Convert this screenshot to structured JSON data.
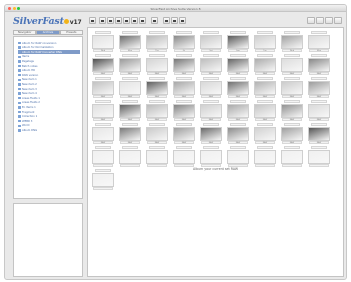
{
  "window": {
    "title": "SilverFast Archive Suite Version 8"
  },
  "logo": {
    "text": "SilverFast",
    "version": "v17"
  },
  "tabs": [
    {
      "label": "Navigator"
    },
    {
      "label": "Archive"
    },
    {
      "label": "Presets"
    }
  ],
  "sidebar": {
    "items": [
      {
        "label": "Album for RAW conversion",
        "selected": false
      },
      {
        "label": "Album for Normalization",
        "selected": false
      },
      {
        "label": "Album for RAW Converter DNG",
        "selected": true
      },
      {
        "label": "Items",
        "selected": false
      },
      {
        "label": "Pagetags",
        "selected": false
      },
      {
        "label": "Batch notes",
        "selected": false
      },
      {
        "label": "Album HR",
        "selected": false
      },
      {
        "label": "RAW version",
        "selected": false
      },
      {
        "label": "New item 1",
        "selected": false
      },
      {
        "label": "New item 2",
        "selected": false
      },
      {
        "label": "New item 3",
        "selected": false
      },
      {
        "label": "New item 4",
        "selected": false
      },
      {
        "label": "Areas Fields 1",
        "selected": false
      },
      {
        "label": "Areas Fields 2",
        "selected": false
      },
      {
        "label": "En Items 1",
        "selected": false
      },
      {
        "label": "Fragment",
        "selected": false
      },
      {
        "label": "Collection 1",
        "selected": false
      },
      {
        "label": "WEBD 3",
        "selected": false
      },
      {
        "label": "World",
        "selected": false
      },
      {
        "label": "Album DNG",
        "selected": false
      }
    ]
  },
  "toolbar": {
    "icons": [
      "lightbox-icon",
      "grid-icon",
      "list-icon",
      "filmstrip-icon",
      "zoom-icon",
      "rotate-icon",
      "print-icon",
      "undo-icon",
      "redo-icon",
      "tag-icon",
      "info-icon"
    ],
    "right_icons": [
      "settings-icon",
      "view-icon",
      "export-icon",
      "help-icon"
    ]
  },
  "thumbnails": [
    {
      "tone": "#e2e2e2",
      "caption": "Wed"
    },
    {
      "tone": "#6d6d6d",
      "caption": "Mon"
    },
    {
      "tone": "#b9b9b9",
      "caption": "Thu"
    },
    {
      "tone": "#8a8a8a",
      "caption": "Fri"
    },
    {
      "tone": "#c8c8c8",
      "caption": "Sat"
    },
    {
      "tone": "#5a5a5a",
      "caption": "Sun"
    },
    {
      "tone": "#cfcfcf",
      "caption": "Tue"
    },
    {
      "tone": "#a3a3a3",
      "caption": "Wed"
    },
    {
      "tone": "#dcdcdc",
      "caption": "Mon"
    },
    {
      "tone": "#4f4f4f",
      "caption": "RAW"
    },
    {
      "tone": "#9a9a9a",
      "caption": "RAW"
    },
    {
      "tone": "#d4d4d4",
      "caption": "RAW"
    },
    {
      "tone": "#777777",
      "caption": "RAW"
    },
    {
      "tone": "#bebebe",
      "caption": "RAW"
    },
    {
      "tone": "#666666",
      "caption": "RAW"
    },
    {
      "tone": "#adadad",
      "caption": "RAW"
    },
    {
      "tone": "#dddddd",
      "caption": "RAW"
    },
    {
      "tone": "#888888",
      "caption": "RAW"
    },
    {
      "tone": "#c2c2c2",
      "caption": "RAW"
    },
    {
      "tone": "#e4e4e4",
      "caption": "RAW"
    },
    {
      "tone": "#5f5f5f",
      "caption": "RAW"
    },
    {
      "tone": "#a8a8a8",
      "caption": "RAW"
    },
    {
      "tone": "#d8d8d8",
      "caption": "RAW"
    },
    {
      "tone": "#707070",
      "caption": "RAW"
    },
    {
      "tone": "#b3b3b3",
      "caption": "RAW"
    },
    {
      "tone": "#cccccc",
      "caption": "RAW"
    },
    {
      "tone": "#9c9c9c",
      "caption": "RAW"
    },
    {
      "tone": "#e0e0e0",
      "caption": "RAW"
    },
    {
      "tone": "#636363",
      "caption": "RAW"
    },
    {
      "tone": "#bcbcbc",
      "caption": "RAW"
    },
    {
      "tone": "#858585",
      "caption": "RAW"
    },
    {
      "tone": "#d0d0d0",
      "caption": "RAW"
    },
    {
      "tone": "#aaaaaa",
      "caption": "RAW"
    },
    {
      "tone": "#c6c6c6",
      "caption": "RAW"
    },
    {
      "tone": "#939393",
      "caption": "RAW"
    },
    {
      "tone": "#dadada",
      "caption": "RAW"
    },
    {
      "tone": "#e6e6e6",
      "caption": "RAW"
    },
    {
      "tone": "#7a7a7a",
      "caption": "RAW"
    },
    {
      "tone": "#cacaca",
      "caption": "RAW"
    },
    {
      "tone": "#9e9e9e",
      "caption": "RAW"
    },
    {
      "tone": "#6a6a6a",
      "caption": "RAW"
    },
    {
      "tone": "#8c8c8c",
      "caption": "RAW"
    },
    {
      "tone": "#d2d2d2",
      "caption": "RAW"
    },
    {
      "tone": "#a0a0a0",
      "caption": "RAW"
    },
    {
      "tone": "#555555",
      "caption": "RAW"
    },
    {
      "tone": "#f0f0f0",
      "caption": ""
    },
    {
      "tone": "#f0f0f0",
      "caption": ""
    },
    {
      "tone": "#f0f0f0",
      "caption": ""
    },
    {
      "tone": "#f0f0f0",
      "caption": ""
    },
    {
      "tone": "#f0f0f0",
      "caption": ""
    },
    {
      "tone": "#f0f0f0",
      "caption": ""
    },
    {
      "tone": "#f0f0f0",
      "caption": ""
    },
    {
      "tone": "#f0f0f0",
      "caption": ""
    },
    {
      "tone": "#f0f0f0",
      "caption": ""
    },
    {
      "tone": "#f0f0f0",
      "caption": ""
    }
  ],
  "status": {
    "text": "Album your current set RAW"
  },
  "colors": {
    "accent": "#7f9bc8",
    "logo": "#4b74b8",
    "logo_ball": "#f2b41a"
  }
}
